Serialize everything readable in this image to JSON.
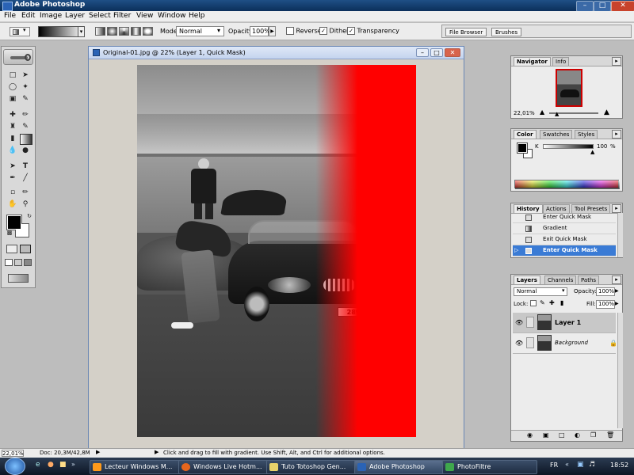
{
  "app": {
    "title": "Adobe Photoshop"
  },
  "menu": [
    "File",
    "Edit",
    "Image",
    "Layer",
    "Select",
    "Filter",
    "View",
    "Window",
    "Help"
  ],
  "options": {
    "mode_label": "Mode:",
    "mode_value": "Normal",
    "opacity_label": "Opacity:",
    "opacity_value": "100%",
    "reverse_label": "Reverse",
    "dither_label": "Dither",
    "transparency_label": "Transparency",
    "reverse_checked": false,
    "dither_checked": true,
    "transparency_checked": true
  },
  "wells": {
    "file_browser": "File Browser",
    "brushes": "Brushes"
  },
  "document": {
    "title": "Original-01.jpg @ 22% (Layer 1, Quick Mask)",
    "plate": "289"
  },
  "navigator": {
    "tabs": [
      "Navigator",
      "Info"
    ],
    "zoom": "22,01%"
  },
  "color": {
    "tabs": [
      "Color",
      "Swatches",
      "Styles"
    ],
    "channel": "K",
    "value": "100",
    "unit": "%"
  },
  "history": {
    "tabs": [
      "History",
      "Actions",
      "Tool Presets"
    ],
    "items": [
      {
        "label": "Enter Quick Mask"
      },
      {
        "label": "Gradient"
      },
      {
        "label": "Exit Quick Mask"
      },
      {
        "label": "Enter Quick Mask"
      }
    ]
  },
  "layers": {
    "tabs": [
      "Layers",
      "Channels",
      "Paths"
    ],
    "blend_mode": "Normal",
    "opacity_label": "Opacity:",
    "opacity_value": "100%",
    "lock_label": "Lock:",
    "fill_label": "Fill:",
    "fill_value": "100%",
    "items": [
      {
        "name": "Layer 1"
      },
      {
        "name": "Background"
      }
    ]
  },
  "status": {
    "zoom": "22,01%",
    "doc": "Doc: 20,3M/42,8M",
    "hint": "Click and drag to fill with gradient.  Use Shift, Alt, and Ctrl for additional options."
  },
  "taskbar": {
    "items": [
      {
        "label": "Lecteur Windows M..."
      },
      {
        "label": "Windows Live Hotm..."
      },
      {
        "label": "Tuto Totoshop Gen..."
      },
      {
        "label": "Adobe Photoshop"
      },
      {
        "label": "PhotoFiltre"
      }
    ],
    "lang": "FR",
    "time": "18:52"
  },
  "colors": {
    "quick_mask": "#ff0000",
    "history_selected": "#3a7bd5",
    "title_bar": "#0b2f5a"
  }
}
